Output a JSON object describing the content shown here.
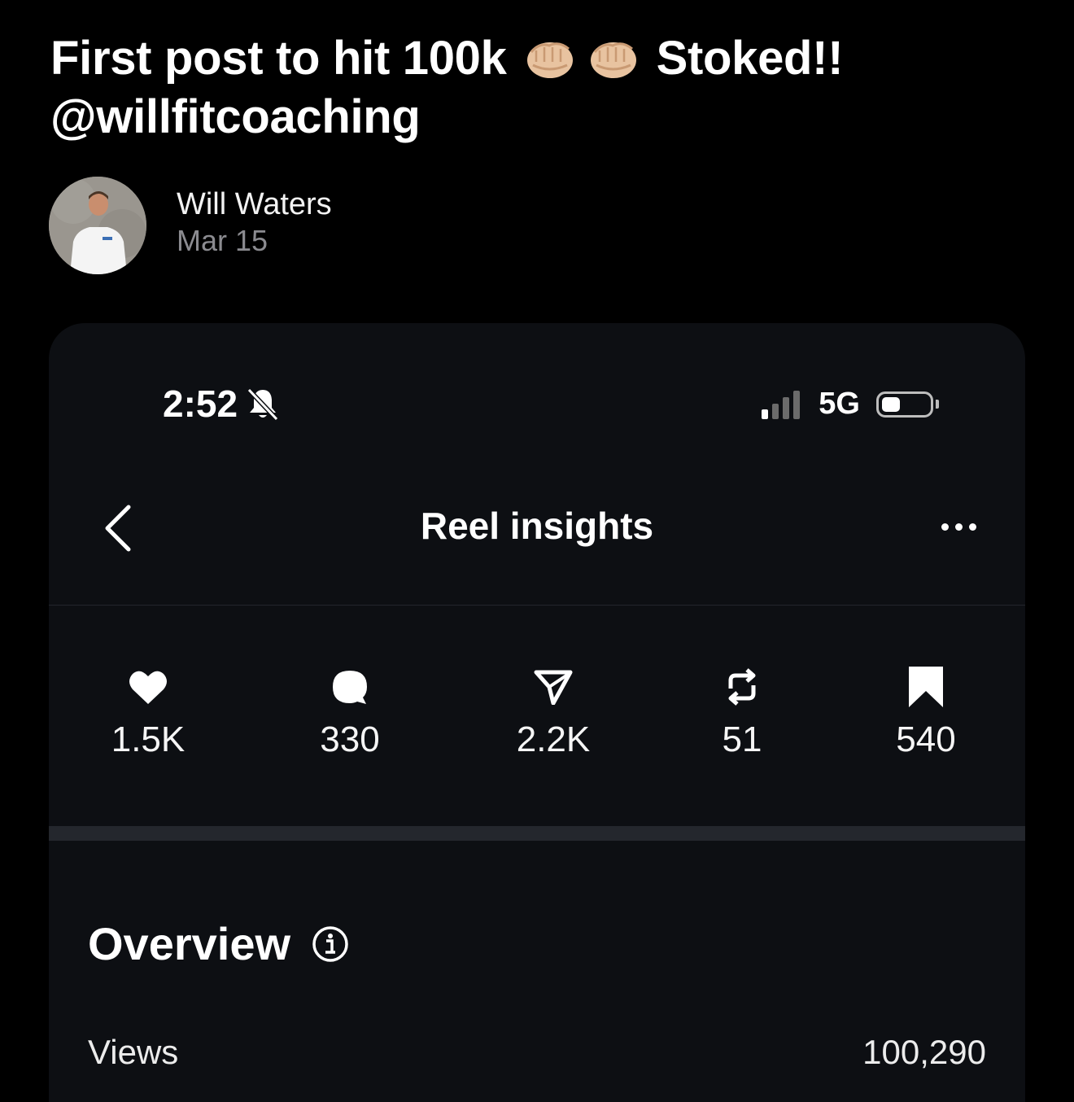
{
  "post": {
    "line1_part1": "First post to hit 100k",
    "line1_part2": "Stoked!!",
    "line2": "@willfitcoaching",
    "emojis": [
      "fist-bump-icon",
      "fist-bump-icon"
    ]
  },
  "author": {
    "name": "Will Waters",
    "date": "Mar 15"
  },
  "phone": {
    "status": {
      "time": "2:52",
      "network": "5G",
      "icons": [
        "bell-slash-icon",
        "signal-icon",
        "battery-icon"
      ]
    },
    "nav": {
      "title": "Reel insights",
      "icons": [
        "back-chevron-icon",
        "more-icon"
      ]
    },
    "stats": [
      {
        "icon": "heart-icon",
        "value": "1.5K"
      },
      {
        "icon": "comment-icon",
        "value": "330"
      },
      {
        "icon": "share-icon",
        "value": "2.2K"
      },
      {
        "icon": "repost-icon",
        "value": "51"
      },
      {
        "icon": "bookmark-icon",
        "value": "540"
      }
    ],
    "overview": {
      "title": "Overview",
      "icon": "info-icon",
      "rows": [
        {
          "label": "Views",
          "value": "100,290"
        }
      ]
    }
  },
  "colors": {
    "background": "#000000",
    "card_background": "#0d0f13",
    "muted_text": "#8b8b90",
    "divider": "#24272d"
  }
}
